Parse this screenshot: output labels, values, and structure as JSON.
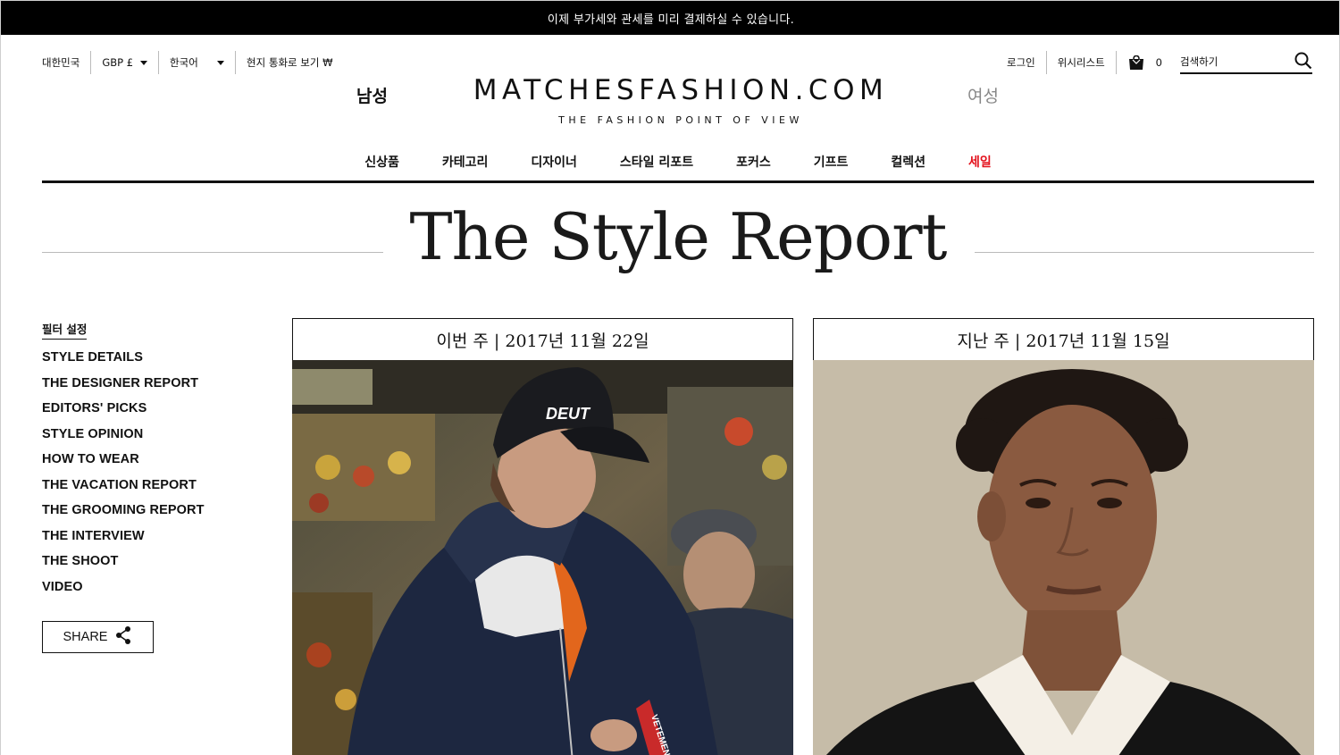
{
  "promo": {
    "text": "이제 부가세와 관세를 미리 결제하실 수 있습니다."
  },
  "utility_left": {
    "country": "대한민국",
    "currency": "GBP £",
    "language": "한국어",
    "local_currency": "현지 통화로 보기 ₩"
  },
  "utility_right": {
    "login": "로그인",
    "wishlist": "위시리스트",
    "bag_count": "0",
    "search_placeholder": "검색하기"
  },
  "header": {
    "men": "남성",
    "logo": "MATCHESFASHION.COM",
    "tagline": "THE FASHION POINT OF VIEW",
    "women": "여성"
  },
  "nav": {
    "items": [
      {
        "label": "신상품"
      },
      {
        "label": "카테고리"
      },
      {
        "label": "디자이너"
      },
      {
        "label": "스타일 리포트"
      },
      {
        "label": "포커스"
      },
      {
        "label": "기프트"
      },
      {
        "label": "컬렉션"
      },
      {
        "label": "세일"
      }
    ]
  },
  "hero": {
    "title": "The Style Report"
  },
  "sidebar": {
    "filter_title": "필터 설정",
    "filters": [
      "STYLE DETAILS",
      "THE DESIGNER REPORT",
      "EDITORS' PICKS",
      "STYLE OPINION",
      "HOW TO WEAR",
      "THE VACATION REPORT",
      "THE GROOMING REPORT",
      "THE INTERVIEW",
      "THE SHOOT",
      "VIDEO"
    ],
    "share_label": "SHARE"
  },
  "cards": [
    {
      "heading": "이번 주 | 2017년 11월 22일",
      "cap_text": "DEUT",
      "tag_text": "VETEMENTS"
    },
    {
      "heading": "지난 주 | 2017년 11월 15일"
    }
  ],
  "colors": {
    "sale": "#e3101b",
    "accent": "#111111",
    "muted": "#888888"
  }
}
